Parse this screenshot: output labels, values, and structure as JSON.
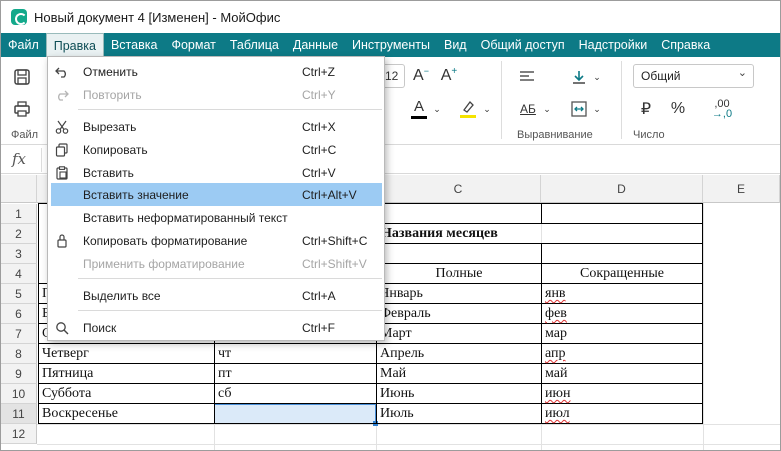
{
  "window": {
    "title": "Новый документ 4 [Изменен] - МойОфис"
  },
  "menubar": [
    "Файл",
    "Правка",
    "Вставка",
    "Формат",
    "Таблица",
    "Данные",
    "Инструменты",
    "Вид",
    "Общий доступ",
    "Надстройки",
    "Справка"
  ],
  "menubar_active_index": 1,
  "toolbar": {
    "font_size": "12",
    "number_format": "Общий",
    "group_labels": {
      "file": "Файл",
      "alignment": "Выравнивание",
      "number": "Число"
    },
    "text_color": "#000000",
    "highlight_color": "#f5e300"
  },
  "formula_bar": {
    "fx": "fx"
  },
  "grid": {
    "visible_columns": [
      "C",
      "D",
      "E"
    ],
    "row_numbers": [
      "1",
      "2",
      "3",
      "4",
      "5",
      "6",
      "7",
      "8",
      "9",
      "10",
      "11",
      "12"
    ],
    "cells": {
      "c2": "Названия месяцев",
      "c4": "Полные",
      "d4": "Сокращенные",
      "a5": "П",
      "a6": "В",
      "a7": "С",
      "c5": "Январь",
      "d5": "янв",
      "c6": "Февраль",
      "d6": "фев",
      "c7": "Март",
      "d7": "мар",
      "a8": "Четверг",
      "b8": "чт",
      "c8": "Апрель",
      "d8": "апр",
      "a9": "Пятница",
      "b9": "пт",
      "c9": "Май",
      "d9": "май",
      "a10": "Суббота",
      "b10": "сб",
      "c10": "Июнь",
      "d10": "июн",
      "a11": "Воскресенье",
      "c11": "Июль",
      "d11": "июл"
    },
    "selected_cell_color": "#dbeaf9"
  },
  "dropdown": {
    "items": [
      {
        "icon": "undo-icon",
        "label": "Отменить",
        "shortcut": "Ctrl+Z",
        "disabled": false
      },
      {
        "icon": "redo-icon",
        "label": "Повторить",
        "shortcut": "Ctrl+Y",
        "disabled": true
      },
      {
        "icon": "cut-icon",
        "label": "Вырезать",
        "shortcut": "Ctrl+X",
        "disabled": false
      },
      {
        "icon": "copy-icon",
        "label": "Копировать",
        "shortcut": "Ctrl+C",
        "disabled": false
      },
      {
        "icon": "paste-icon",
        "label": "Вставить",
        "shortcut": "Ctrl+V",
        "disabled": false
      },
      {
        "icon": "",
        "label": "Вставить значение",
        "shortcut": "Ctrl+Alt+V",
        "disabled": false,
        "highlighted": true
      },
      {
        "icon": "",
        "label": "Вставить неформатированный текст",
        "shortcut": "",
        "disabled": false
      },
      {
        "icon": "format-painter-icon",
        "label": "Копировать форматирование",
        "shortcut": "Ctrl+Shift+C",
        "disabled": false
      },
      {
        "icon": "",
        "label": "Применить форматирование",
        "shortcut": "Ctrl+Shift+V",
        "disabled": true
      },
      {
        "icon": "",
        "label": "Выделить все",
        "shortcut": "Ctrl+A",
        "disabled": false
      },
      {
        "icon": "search-icon",
        "label": "Поиск",
        "shortcut": "Ctrl+F",
        "disabled": false
      }
    ]
  }
}
